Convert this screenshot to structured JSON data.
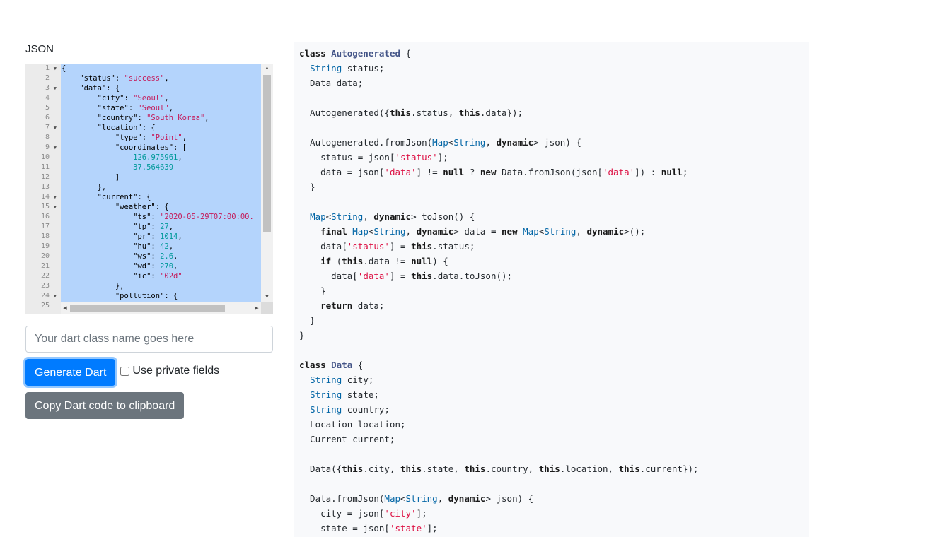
{
  "left": {
    "json_label": "JSON",
    "editor": {
      "line_numbers": [
        "1",
        "2",
        "3",
        "4",
        "5",
        "6",
        "7",
        "8",
        "9",
        "10",
        "11",
        "12",
        "13",
        "14",
        "15",
        "16",
        "17",
        "18",
        "19",
        "20",
        "21",
        "22",
        "23",
        "24",
        "25"
      ],
      "lines": [
        [
          {
            "t": "{",
            "c": "k"
          }
        ],
        [
          {
            "t": "    \"status\": ",
            "c": "k"
          },
          {
            "t": "\"success\"",
            "c": "s"
          },
          {
            "t": ",",
            "c": "k"
          }
        ],
        [
          {
            "t": "    \"data\": {",
            "c": "k"
          }
        ],
        [
          {
            "t": "        \"city\": ",
            "c": "k"
          },
          {
            "t": "\"Seoul\"",
            "c": "s"
          },
          {
            "t": ",",
            "c": "k"
          }
        ],
        [
          {
            "t": "        \"state\": ",
            "c": "k"
          },
          {
            "t": "\"Seoul\"",
            "c": "s"
          },
          {
            "t": ",",
            "c": "k"
          }
        ],
        [
          {
            "t": "        \"country\": ",
            "c": "k"
          },
          {
            "t": "\"South Korea\"",
            "c": "s"
          },
          {
            "t": ",",
            "c": "k"
          }
        ],
        [
          {
            "t": "        \"location\": {",
            "c": "k"
          }
        ],
        [
          {
            "t": "            \"type\": ",
            "c": "k"
          },
          {
            "t": "\"Point\"",
            "c": "s"
          },
          {
            "t": ",",
            "c": "k"
          }
        ],
        [
          {
            "t": "            \"coordinates\": [",
            "c": "k"
          }
        ],
        [
          {
            "t": "                ",
            "c": "k"
          },
          {
            "t": "126.975961",
            "c": "n"
          },
          {
            "t": ",",
            "c": "k"
          }
        ],
        [
          {
            "t": "                ",
            "c": "k"
          },
          {
            "t": "37.564639",
            "c": "n"
          }
        ],
        [
          {
            "t": "            ]",
            "c": "k"
          }
        ],
        [
          {
            "t": "        },",
            "c": "k"
          }
        ],
        [
          {
            "t": "        \"current\": {",
            "c": "k"
          }
        ],
        [
          {
            "t": "            \"weather\": {",
            "c": "k"
          }
        ],
        [
          {
            "t": "                \"ts\": ",
            "c": "k"
          },
          {
            "t": "\"2020-05-29T07:00:00.",
            "c": "s"
          }
        ],
        [
          {
            "t": "                \"tp\": ",
            "c": "k"
          },
          {
            "t": "27",
            "c": "n"
          },
          {
            "t": ",",
            "c": "k"
          }
        ],
        [
          {
            "t": "                \"pr\": ",
            "c": "k"
          },
          {
            "t": "1014",
            "c": "n"
          },
          {
            "t": ",",
            "c": "k"
          }
        ],
        [
          {
            "t": "                \"hu\": ",
            "c": "k"
          },
          {
            "t": "42",
            "c": "n"
          },
          {
            "t": ",",
            "c": "k"
          }
        ],
        [
          {
            "t": "                \"ws\": ",
            "c": "k"
          },
          {
            "t": "2.6",
            "c": "n"
          },
          {
            "t": ",",
            "c": "k"
          }
        ],
        [
          {
            "t": "                \"wd\": ",
            "c": "k"
          },
          {
            "t": "270",
            "c": "n"
          },
          {
            "t": ",",
            "c": "k"
          }
        ],
        [
          {
            "t": "                \"ic\": ",
            "c": "k"
          },
          {
            "t": "\"02d\"",
            "c": "s"
          }
        ],
        [
          {
            "t": "            },",
            "c": "k"
          }
        ],
        [
          {
            "t": "            \"pollution\": {",
            "c": "k"
          }
        ]
      ]
    },
    "class_name_input": {
      "placeholder": "Your dart class name goes here",
      "value": ""
    },
    "generate_button": "Generate Dart",
    "private_fields_label": "Use private fields",
    "private_fields_checked": false,
    "copy_button": "Copy Dart code to clipboard"
  },
  "dart_output": [
    [
      {
        "t": "class ",
        "c": "kw"
      },
      {
        "t": "Autogenerated",
        "c": "cls"
      },
      {
        "t": " {",
        "c": ""
      }
    ],
    [
      {
        "t": "  ",
        "c": ""
      },
      {
        "t": "String",
        "c": "ty"
      },
      {
        "t": " status;",
        "c": ""
      }
    ],
    [
      {
        "t": "  Data data;",
        "c": ""
      }
    ],
    [],
    [
      {
        "t": "  Autogenerated({",
        "c": ""
      },
      {
        "t": "this",
        "c": "kw"
      },
      {
        "t": ".status, ",
        "c": ""
      },
      {
        "t": "this",
        "c": "kw"
      },
      {
        "t": ".data});",
        "c": ""
      }
    ],
    [],
    [
      {
        "t": "  Autogenerated.fromJson(",
        "c": ""
      },
      {
        "t": "Map",
        "c": "ty"
      },
      {
        "t": "<",
        "c": ""
      },
      {
        "t": "String",
        "c": "ty"
      },
      {
        "t": ", ",
        "c": ""
      },
      {
        "t": "dynamic",
        "c": "kw"
      },
      {
        "t": "> json) {",
        "c": ""
      }
    ],
    [
      {
        "t": "    status = json[",
        "c": ""
      },
      {
        "t": "'status'",
        "c": "str"
      },
      {
        "t": "];",
        "c": ""
      }
    ],
    [
      {
        "t": "    data = json[",
        "c": ""
      },
      {
        "t": "'data'",
        "c": "str"
      },
      {
        "t": "] != ",
        "c": ""
      },
      {
        "t": "null",
        "c": "kw"
      },
      {
        "t": " ? ",
        "c": ""
      },
      {
        "t": "new",
        "c": "kw"
      },
      {
        "t": " Data.fromJson(json[",
        "c": ""
      },
      {
        "t": "'data'",
        "c": "str"
      },
      {
        "t": "]) : ",
        "c": ""
      },
      {
        "t": "null",
        "c": "kw"
      },
      {
        "t": ";",
        "c": ""
      }
    ],
    [
      {
        "t": "  }",
        "c": ""
      }
    ],
    [],
    [
      {
        "t": "  ",
        "c": ""
      },
      {
        "t": "Map",
        "c": "ty"
      },
      {
        "t": "<",
        "c": ""
      },
      {
        "t": "String",
        "c": "ty"
      },
      {
        "t": ", ",
        "c": ""
      },
      {
        "t": "dynamic",
        "c": "kw"
      },
      {
        "t": "> toJson() {",
        "c": ""
      }
    ],
    [
      {
        "t": "    ",
        "c": ""
      },
      {
        "t": "final",
        "c": "kw"
      },
      {
        "t": " ",
        "c": ""
      },
      {
        "t": "Map",
        "c": "ty"
      },
      {
        "t": "<",
        "c": ""
      },
      {
        "t": "String",
        "c": "ty"
      },
      {
        "t": ", ",
        "c": ""
      },
      {
        "t": "dynamic",
        "c": "kw"
      },
      {
        "t": "> data = ",
        "c": ""
      },
      {
        "t": "new",
        "c": "kw"
      },
      {
        "t": " ",
        "c": ""
      },
      {
        "t": "Map",
        "c": "ty"
      },
      {
        "t": "<",
        "c": ""
      },
      {
        "t": "String",
        "c": "ty"
      },
      {
        "t": ", ",
        "c": ""
      },
      {
        "t": "dynamic",
        "c": "kw"
      },
      {
        "t": ">();",
        "c": ""
      }
    ],
    [
      {
        "t": "    data[",
        "c": ""
      },
      {
        "t": "'status'",
        "c": "str"
      },
      {
        "t": "] = ",
        "c": ""
      },
      {
        "t": "this",
        "c": "kw"
      },
      {
        "t": ".status;",
        "c": ""
      }
    ],
    [
      {
        "t": "    ",
        "c": ""
      },
      {
        "t": "if",
        "c": "kw"
      },
      {
        "t": " (",
        "c": ""
      },
      {
        "t": "this",
        "c": "kw"
      },
      {
        "t": ".data != ",
        "c": ""
      },
      {
        "t": "null",
        "c": "kw"
      },
      {
        "t": ") {",
        "c": ""
      }
    ],
    [
      {
        "t": "      data[",
        "c": ""
      },
      {
        "t": "'data'",
        "c": "str"
      },
      {
        "t": "] = ",
        "c": ""
      },
      {
        "t": "this",
        "c": "kw"
      },
      {
        "t": ".data.toJson();",
        "c": ""
      }
    ],
    [
      {
        "t": "    }",
        "c": ""
      }
    ],
    [
      {
        "t": "    ",
        "c": ""
      },
      {
        "t": "return",
        "c": "kw"
      },
      {
        "t": " data;",
        "c": ""
      }
    ],
    [
      {
        "t": "  }",
        "c": ""
      }
    ],
    [
      {
        "t": "}",
        "c": ""
      }
    ],
    [],
    [
      {
        "t": "class ",
        "c": "kw"
      },
      {
        "t": "Data",
        "c": "cls"
      },
      {
        "t": " {",
        "c": ""
      }
    ],
    [
      {
        "t": "  ",
        "c": ""
      },
      {
        "t": "String",
        "c": "ty"
      },
      {
        "t": " city;",
        "c": ""
      }
    ],
    [
      {
        "t": "  ",
        "c": ""
      },
      {
        "t": "String",
        "c": "ty"
      },
      {
        "t": " state;",
        "c": ""
      }
    ],
    [
      {
        "t": "  ",
        "c": ""
      },
      {
        "t": "String",
        "c": "ty"
      },
      {
        "t": " country;",
        "c": ""
      }
    ],
    [
      {
        "t": "  Location location;",
        "c": ""
      }
    ],
    [
      {
        "t": "  Current current;",
        "c": ""
      }
    ],
    [],
    [
      {
        "t": "  Data({",
        "c": ""
      },
      {
        "t": "this",
        "c": "kw"
      },
      {
        "t": ".city, ",
        "c": ""
      },
      {
        "t": "this",
        "c": "kw"
      },
      {
        "t": ".state, ",
        "c": ""
      },
      {
        "t": "this",
        "c": "kw"
      },
      {
        "t": ".country, ",
        "c": ""
      },
      {
        "t": "this",
        "c": "kw"
      },
      {
        "t": ".location, ",
        "c": ""
      },
      {
        "t": "this",
        "c": "kw"
      },
      {
        "t": ".current});",
        "c": ""
      }
    ],
    [],
    [
      {
        "t": "  Data.fromJson(",
        "c": ""
      },
      {
        "t": "Map",
        "c": "ty"
      },
      {
        "t": "<",
        "c": ""
      },
      {
        "t": "String",
        "c": "ty"
      },
      {
        "t": ", ",
        "c": ""
      },
      {
        "t": "dynamic",
        "c": "kw"
      },
      {
        "t": "> json) {",
        "c": ""
      }
    ],
    [
      {
        "t": "    city = json[",
        "c": ""
      },
      {
        "t": "'city'",
        "c": "str"
      },
      {
        "t": "];",
        "c": ""
      }
    ],
    [
      {
        "t": "    state = json[",
        "c": ""
      },
      {
        "t": "'state'",
        "c": "str"
      },
      {
        "t": "];",
        "c": ""
      }
    ]
  ]
}
